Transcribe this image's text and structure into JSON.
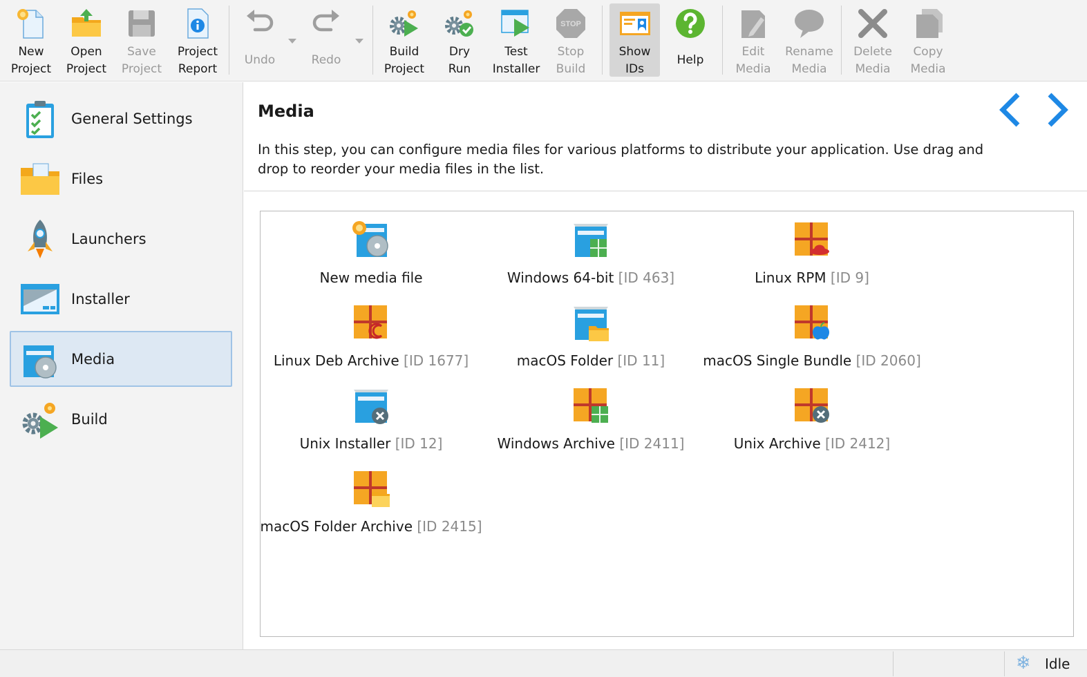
{
  "toolbar": {
    "new_project": "New\nProject",
    "open_project": "Open\nProject",
    "save_project": "Save\nProject",
    "project_report": "Project\nReport",
    "undo": "Undo",
    "redo": "Redo",
    "build_project": "Build\nProject",
    "dry_run": "Dry\nRun",
    "test_installer": "Test\nInstaller",
    "stop_build": "Stop\nBuild",
    "show_ids": "Show\nIDs",
    "help": "Help",
    "edit_media": "Edit\nMedia",
    "rename_media": "Rename\nMedia",
    "delete_media": "Delete\nMedia",
    "copy_media": "Copy\nMedia",
    "stop_sign_text": "STOP"
  },
  "sidebar": {
    "items": [
      {
        "label": "General Settings",
        "icon": "clipboard-checklist-icon"
      },
      {
        "label": "Files",
        "icon": "folder-icon"
      },
      {
        "label": "Launchers",
        "icon": "rocket-icon"
      },
      {
        "label": "Installer",
        "icon": "installer-window-icon"
      },
      {
        "label": "Media",
        "icon": "media-disc-icon",
        "selected": true
      },
      {
        "label": "Build",
        "icon": "build-gear-icon"
      }
    ]
  },
  "main": {
    "title": "Media",
    "description": "In this step, you can configure media files for various platforms to distribute your application. Use drag and drop to reorder your media files in the list.",
    "media": [
      {
        "name": "New media file",
        "id": ""
      },
      {
        "name": "Windows 64-bit",
        "id": "[ID 463]"
      },
      {
        "name": "Linux RPM",
        "id": "[ID 9]"
      },
      {
        "name": "Linux Deb Archive",
        "id": "[ID 1677]"
      },
      {
        "name": "macOS Folder",
        "id": "[ID 11]"
      },
      {
        "name": "macOS Single Bundle",
        "id": "[ID 2060]"
      },
      {
        "name": "Unix Installer",
        "id": "[ID 12]"
      },
      {
        "name": "Windows Archive",
        "id": "[ID 2411]"
      },
      {
        "name": "Unix Archive",
        "id": "[ID 2412]"
      },
      {
        "name": "macOS Folder Archive",
        "id": "[ID 2415]"
      }
    ]
  },
  "status": {
    "text": "Idle",
    "icon": "snowflake-icon"
  },
  "colors": {
    "accent_blue": "#1e88e5",
    "selection_bg": "#dde8f3",
    "selection_border": "#9fc3e6",
    "orange": "#f5a623",
    "help_green": "#5cb531",
    "id_gray": "#8a8a8a"
  }
}
